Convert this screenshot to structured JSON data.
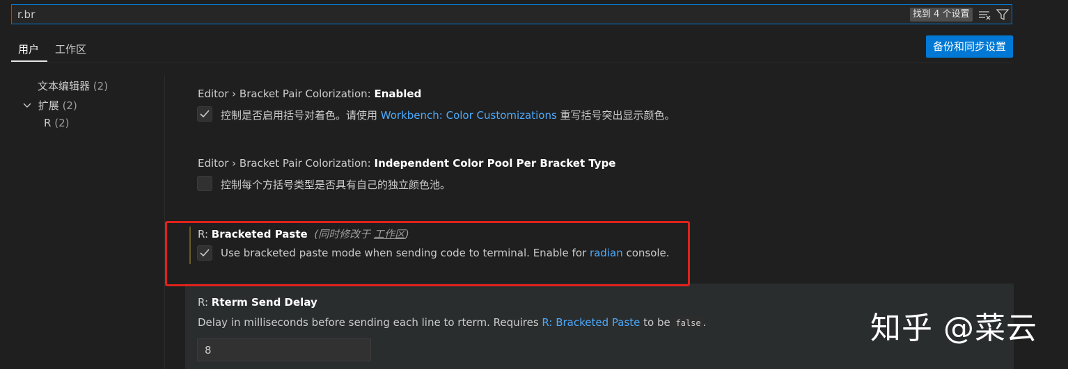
{
  "search": {
    "value": "r.br",
    "result_count": "找到 4 个设置"
  },
  "tabs": [
    {
      "label": "用户"
    },
    {
      "label": "工作区"
    }
  ],
  "sync_button": "备份和同步设置",
  "toc": [
    {
      "label": "文本编辑器",
      "count": "(2)"
    },
    {
      "label": "扩展",
      "count": "(2)"
    },
    {
      "label": "R",
      "count": "(2)"
    }
  ],
  "settings": [
    {
      "category": "Editor › Bracket Pair Colorization: ",
      "name": "Enabled",
      "checked": true,
      "desc_before": "控制是否启用括号对着色。请使用 ",
      "desc_link": "Workbench: Color Customizations",
      "desc_after": " 重写括号突出显示颜色。"
    },
    {
      "category": "Editor › Bracket Pair Colorization: ",
      "name": "Independent Color Pool Per Bracket Type",
      "checked": false,
      "desc": "控制每个方括号类型是否具有自己的独立颜色池。"
    },
    {
      "category": "R: ",
      "name": "Bracketed Paste",
      "modified_prefix": "(同时修改于 ",
      "modified_link": "工作区",
      "modified_suffix": ")",
      "checked": true,
      "desc_before": "Use bracketed paste mode when sending code to terminal. Enable for ",
      "desc_link": "radian",
      "desc_after": " console."
    },
    {
      "category": "R: ",
      "name": "Rterm Send Delay",
      "desc_before": "Delay in milliseconds before sending each line to rterm. Requires ",
      "desc_link": "R: Bracketed Paste",
      "desc_middle": " to be ",
      "desc_code": "false",
      "desc_after": ".",
      "value": "8"
    }
  ],
  "watermark": "知乎 @菜云",
  "colors": {
    "accent": "#0078d4",
    "link": "#4daafc",
    "highlight_box": "#e0221b"
  }
}
